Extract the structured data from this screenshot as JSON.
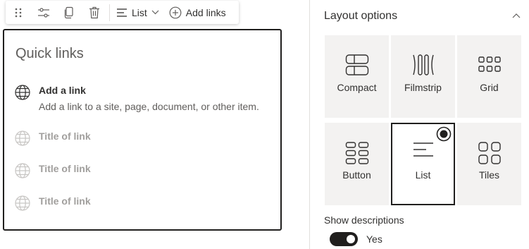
{
  "toolbar": {
    "layout_label": "List",
    "add_links_label": "Add links"
  },
  "webpart": {
    "title": "Quick links",
    "items": [
      {
        "title": "Add a link",
        "description": "Add a link to a site, page, document, or other item.",
        "icon": "globe-icon"
      },
      {
        "title": "Title of link",
        "icon": "globe-icon"
      },
      {
        "title": "Title of link",
        "icon": "globe-icon"
      },
      {
        "title": "Title of link",
        "icon": "globe-icon"
      }
    ]
  },
  "panel": {
    "header": "Layout options",
    "layouts": [
      {
        "label": "Compact",
        "icon": "compact-layout-icon",
        "selected": false
      },
      {
        "label": "Filmstrip",
        "icon": "filmstrip-layout-icon",
        "selected": false
      },
      {
        "label": "Grid",
        "icon": "grid-layout-icon",
        "selected": false
      },
      {
        "label": "Button",
        "icon": "button-layout-icon",
        "selected": false
      },
      {
        "label": "List",
        "icon": "list-layout-icon",
        "selected": true
      },
      {
        "label": "Tiles",
        "icon": "tiles-layout-icon",
        "selected": false
      }
    ],
    "show_descriptions_label": "Show descriptions",
    "show_descriptions_value": "Yes",
    "show_descriptions_on": true
  },
  "colors": {
    "accent": "#201f1e",
    "tile_bg": "#f3f2f1",
    "placeholder_text": "#a19f9d"
  }
}
